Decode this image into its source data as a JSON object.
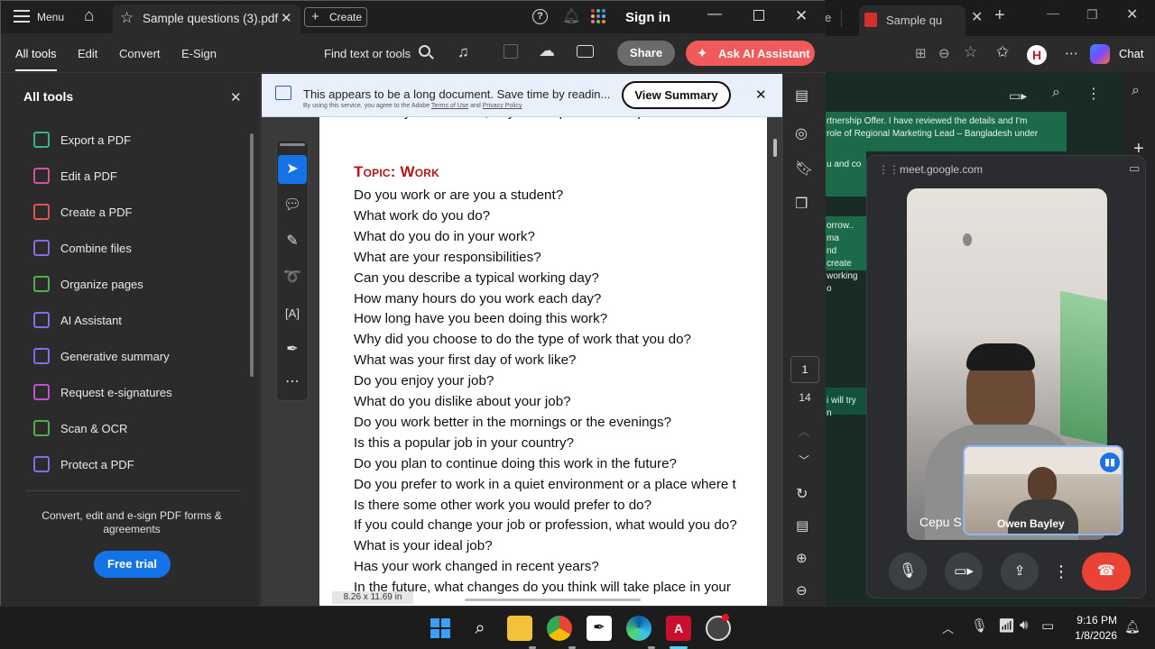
{
  "acrobat": {
    "menu_label": "Menu",
    "tab_title": "Sample questions (3).pdf",
    "create_label": "Create",
    "sign_in": "Sign in",
    "menus": [
      "All tools",
      "Edit",
      "Convert",
      "E-Sign"
    ],
    "find_label": "Find text or tools",
    "share_label": "Share",
    "ai_label": "Ask AI Assistant",
    "panel_title": "All tools",
    "tools": [
      {
        "label": "Export a PDF",
        "color": "#2fb68a"
      },
      {
        "label": "Edit a PDF",
        "color": "#d94fa0"
      },
      {
        "label": "Create a PDF",
        "color": "#e0524f"
      },
      {
        "label": "Combine files",
        "color": "#8b6ae0"
      },
      {
        "label": "Organize pages",
        "color": "#4cb04c"
      },
      {
        "label": "AI Assistant",
        "color": "#7d6ff0"
      },
      {
        "label": "Generative summary",
        "color": "#7d6ff0"
      },
      {
        "label": "Request e-signatures",
        "color": "#c34fd6"
      },
      {
        "label": "Scan & OCR",
        "color": "#4cb04c"
      },
      {
        "label": "Protect a PDF",
        "color": "#8b6ae0"
      }
    ],
    "promo_text": "Convert, edit and e-sign PDF forms & agreements",
    "free_trial": "Free trial",
    "banner_text": "This appears to be a long document. Save time by readin...",
    "banner_small": "By using this service, you agree to the Adobe",
    "banner_terms": "Terms of Use",
    "banner_and": "and",
    "banner_privacy": "Privacy Policy",
    "view_summary": "View Summary",
    "topic": "Topic: Work",
    "questions": [
      "Do you work or are you a student?",
      "What work do you do?",
      "What do you do in your work?",
      "What are your responsibilities?",
      "Can you describe a typical working day?",
      "How many hours do you work each day?",
      "How long have you been doing this work?",
      "Why did you choose to do the type of work that you do?",
      "What was your first day of work like?",
      "Do you enjoy your job?",
      "What do you dislike about your job?",
      "Do you work better in the mornings or the evenings?",
      "Is this a popular job in your country?",
      "Do you plan to continue doing this work in the future?",
      "Do you prefer to work in a quiet environment or a place where t",
      "Is there some other work you would prefer to do?",
      "If you could change your job or profession, what would you do?",
      "What is your ideal job?",
      "Has your work changed in recent years?",
      "In the future, what changes do you think will take place in your"
    ],
    "page_current": "1",
    "page_total": "14",
    "page_size": "8.26 x 11.69 in"
  },
  "browser": {
    "tab_title": "Sample qu",
    "chat_label": "Chat",
    "messages": [
      "rtnership Offer. I have reviewed the details and I'm",
      "role of Regional Marketing Lead – Bangladesh under",
      "u and co",
      "orrow.. ma",
      "nd create",
      "working o",
      "i will try n"
    ]
  },
  "meet": {
    "url": "meet.google.com",
    "main_name": "Cepu S",
    "self_name": "Owen Bayley"
  },
  "taskbar": {
    "time": "9:16 PM",
    "date": "1/8/2026"
  },
  "colors": {
    "accent_red": "#f05a5a",
    "link_blue": "#1473e6",
    "topic_red": "#b01818"
  }
}
